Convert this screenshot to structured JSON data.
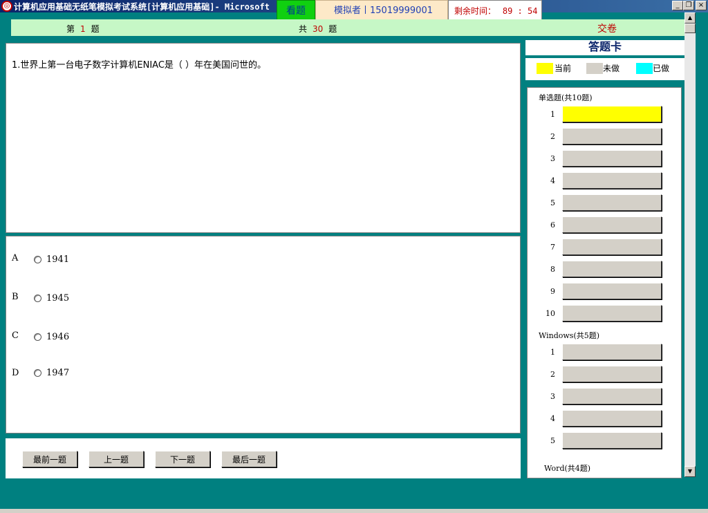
{
  "window": {
    "title": "计算机应用基础无纸笔模拟考试系统[计算机应用基础]- Microsoft",
    "app_icon": "seal-icon",
    "minimize_glyph": "_",
    "restore_glyph": "❐",
    "close_glyph": "×"
  },
  "header": {
    "view_question_label": "看题",
    "examinee_label": "模拟者丨15019999001",
    "timer_label": "剩余时间：",
    "timer_value": "89 : 54"
  },
  "nav": {
    "question_prefix": "第",
    "current_index": "1",
    "question_suffix": "题",
    "total_prefix": "共",
    "total_count": "30",
    "total_suffix": "题",
    "submit_label": "交卷"
  },
  "question": {
    "text": "1.世界上第一台电子数字计算机ENIAC是（    ）年在美国问世的。",
    "options": [
      {
        "letter": "A",
        "text": "1941"
      },
      {
        "letter": "B",
        "text": "1945"
      },
      {
        "letter": "C",
        "text": "1946"
      },
      {
        "letter": "D",
        "text": "1947"
      }
    ]
  },
  "buttons": {
    "first": "最前一题",
    "prev": "上一题",
    "next": "下一题",
    "last": "最后一题"
  },
  "answer_card": {
    "title": "答题卡",
    "legend": [
      {
        "label": "当前",
        "color": "#ffff00"
      },
      {
        "label": "未做",
        "color": "#d4d0c8"
      },
      {
        "label": "已做",
        "color": "#00ffff"
      }
    ],
    "sections": [
      {
        "label": "单选题(共10题)",
        "items": [
          "1",
          "2",
          "3",
          "4",
          "5",
          "6",
          "7",
          "8",
          "9",
          "10"
        ]
      },
      {
        "label": "Windows(共5题)",
        "items": [
          "1",
          "2",
          "3",
          "4",
          "5"
        ]
      },
      {
        "label": "Word(共4题)",
        "items": []
      }
    ]
  },
  "scrollbar": {
    "up_glyph": "▲",
    "down_glyph": "▼"
  }
}
